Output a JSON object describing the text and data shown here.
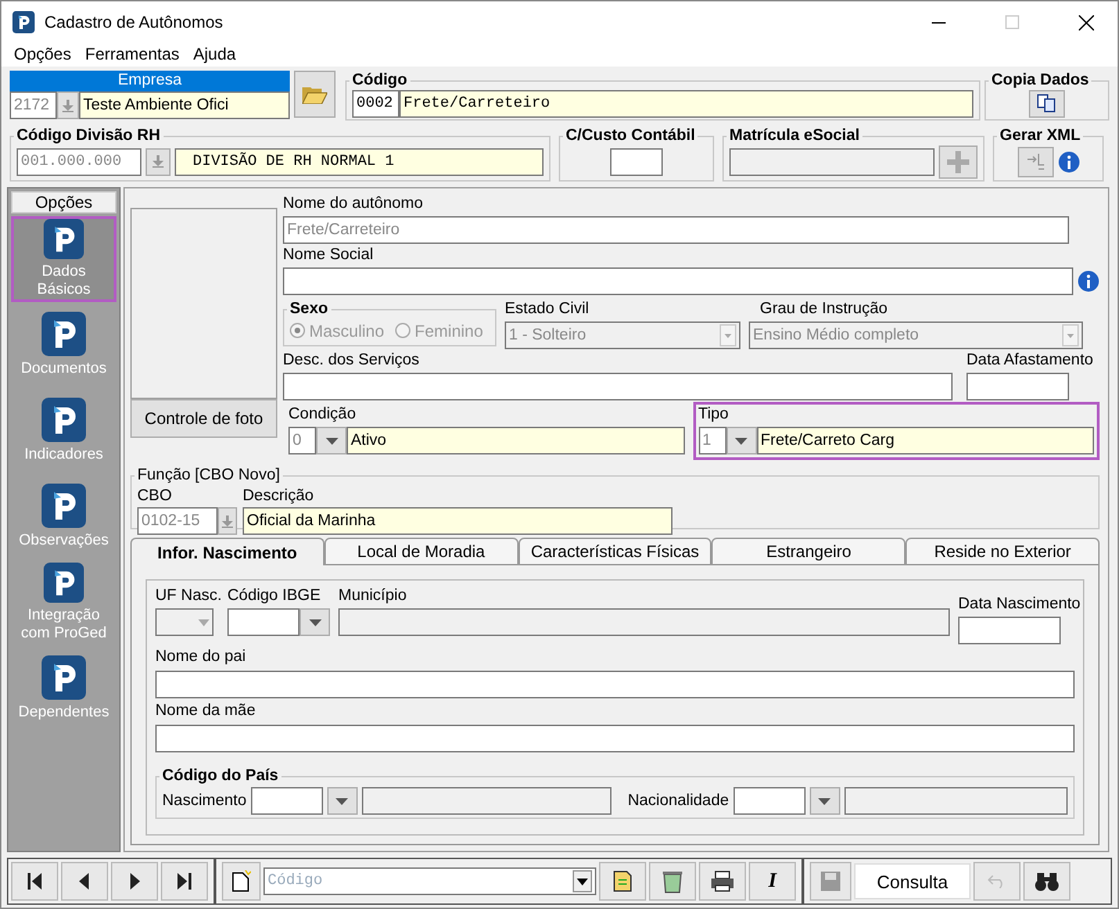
{
  "window": {
    "title": "Cadastro de Autônomos"
  },
  "menu": [
    "Opções",
    "Ferramentas",
    "Ajuda"
  ],
  "empresa": {
    "label": "Empresa",
    "code": "2172",
    "name": "Teste Ambiente Ofici"
  },
  "codigo": {
    "label": "Código",
    "code": "0002",
    "name": "Frete/Carreteiro"
  },
  "copia_dados": {
    "label": "Copia Dados"
  },
  "divisao_rh": {
    "label": "Código Divisão RH",
    "code": "001.000.000",
    "name": "DIVISÃO DE RH NORMAL 1"
  },
  "custo": {
    "label": "C/Custo Contábil"
  },
  "matricula": {
    "label": "Matrícula eSocial"
  },
  "gerar_xml": {
    "label": "Gerar XML"
  },
  "sidebar": {
    "title": "Opções",
    "items": [
      {
        "label": "Dados Básicos",
        "selected": true
      },
      {
        "label": "Documentos",
        "selected": false
      },
      {
        "label": "Indicadores",
        "selected": false
      },
      {
        "label": "Observações",
        "selected": false
      },
      {
        "label": "Integração com ProGed",
        "selected": false
      },
      {
        "label": "Dependentes",
        "selected": false
      }
    ]
  },
  "form": {
    "photo_button": "Controle de foto",
    "nome": {
      "label": "Nome do autônomo",
      "value": "Frete/Carreteiro",
      "disabled": true
    },
    "nome_social": {
      "label": "Nome Social"
    },
    "sexo": {
      "label": "Sexo",
      "options": [
        {
          "label": "Masculino",
          "selected": true
        },
        {
          "label": "Feminino",
          "selected": false
        }
      ]
    },
    "estado_civil": {
      "label": "Estado Civil",
      "value": "1 - Solteiro",
      "disabled": true
    },
    "grau": {
      "label": "Grau de Instrução",
      "value": "Ensino Médio completo",
      "disabled": true
    },
    "desc": {
      "label": "Desc. dos Serviços"
    },
    "data_afast": {
      "label": "Data Afastamento"
    },
    "condicao": {
      "label": "Condição",
      "code": "0",
      "value": "Ativo",
      "highlighted": false
    },
    "tipo": {
      "label": "Tipo",
      "code": "1",
      "value": "Frete/Carreto Carg",
      "highlighted": true
    },
    "funcao": {
      "label": "Função [CBO Novo]",
      "cbo_label": "CBO",
      "cbo": "0102-15",
      "desc_label": "Descrição",
      "desc": "Oficial da Marinha"
    }
  },
  "tabs": [
    {
      "label": "Infor. Nascimento",
      "selected": true
    },
    {
      "label": "Local de Moradia",
      "selected": false
    },
    {
      "label": "Características Físicas",
      "selected": false
    },
    {
      "label": "Estrangeiro",
      "selected": false
    },
    {
      "label": "Reside no Exterior",
      "selected": false
    }
  ],
  "birth": {
    "uf_label": "UF Nasc.",
    "ibge_label": "Código IBGE",
    "municipio_label": "Município",
    "data_label": "Data Nascimento",
    "pai_label": "Nome do pai",
    "mae_label": "Nome da mãe",
    "pais": {
      "label": "Código do País",
      "nascimento_label": "Nascimento",
      "nacionalidade_label": "Nacionalidade"
    }
  },
  "toolbar": {
    "search_placeholder": "Código",
    "italic_key": "I",
    "mode": "Consulta"
  }
}
